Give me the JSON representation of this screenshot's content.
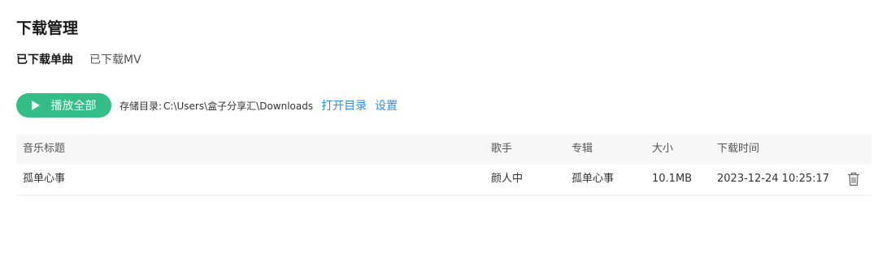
{
  "page": {
    "title": "下载管理"
  },
  "tabs": [
    {
      "label": "已下载单曲",
      "active": true
    },
    {
      "label": "已下载MV",
      "active": false
    }
  ],
  "toolbar": {
    "play_all_label": "播放全部",
    "storage_label": "存储目录:",
    "storage_path": "C:\\Users\\盒子分享汇\\Downloads",
    "open_dir_label": "打开目录",
    "settings_label": "设置",
    "accent_color": "#33be87",
    "link_color": "#2b8ee8"
  },
  "table": {
    "columns": [
      "音乐标题",
      "歌手",
      "专辑",
      "大小",
      "下载时间"
    ],
    "rows": [
      {
        "title": "孤单心事",
        "artist": "颜人中",
        "album": "孤单心事",
        "size": "10.1MB",
        "time": "2023-12-24 10:25:17",
        "action_icon": "trash-icon"
      }
    ]
  }
}
